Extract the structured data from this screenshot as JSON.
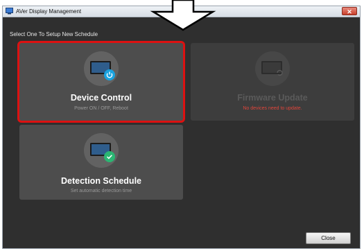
{
  "window": {
    "title": "AVer Display Management",
    "close_glyph": "✕"
  },
  "prompt": "Select One To Setup New Schedule",
  "cards": [
    {
      "title": "Device Control",
      "subtitle": "Power ON / OFF, Reboot",
      "icon": "monitor-power-icon",
      "badge_color": "#1aa3e0",
      "selected": true,
      "enabled": true
    },
    {
      "title": "Firmware Update",
      "subtitle": "No devices need to update.",
      "icon": "monitor-refresh-icon",
      "enabled": false
    },
    {
      "title": "Detection Schedule",
      "subtitle": "Set automatic detection time",
      "icon": "monitor-check-icon",
      "badge_color": "#2bb673",
      "enabled": true
    }
  ],
  "footer": {
    "close_label": "Close"
  },
  "colors": {
    "selection": "#dd1111",
    "warning_text": "#e0453b"
  }
}
